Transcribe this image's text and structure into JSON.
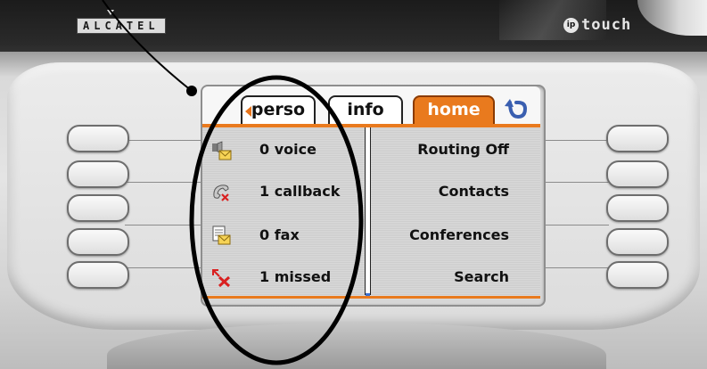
{
  "brand": {
    "logo_text": "ALCATEL",
    "product_badge": "ip",
    "product_name": "touch"
  },
  "tabs": [
    {
      "label": "perso"
    },
    {
      "label": "info"
    },
    {
      "label": "home"
    }
  ],
  "left_items": [
    {
      "label": "0 voice",
      "icon": "voicemail-icon"
    },
    {
      "label": "1 callback",
      "icon": "callback-icon"
    },
    {
      "label": "0 fax",
      "icon": "fax-icon"
    },
    {
      "label": "1 missed",
      "icon": "missed-call-icon"
    }
  ],
  "right_items": [
    {
      "label": "Routing Off"
    },
    {
      "label": "Contacts"
    },
    {
      "label": "Conferences"
    },
    {
      "label": "Search"
    }
  ],
  "colors": {
    "accent": "#e97a1e",
    "annotation": "#000000"
  },
  "annotation": {
    "shape": "ellipse",
    "target": "left_items"
  }
}
